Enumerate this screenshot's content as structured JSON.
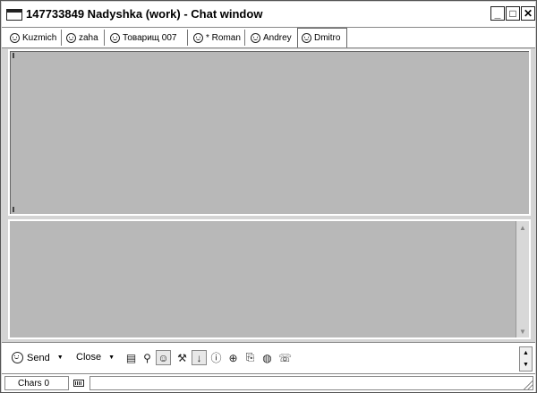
{
  "window": {
    "title": "147733849 Nadyshka (work) - Chat window",
    "min_label": "_",
    "max_label": "□",
    "close_label": "✕"
  },
  "tabs": [
    {
      "label": "Kuzmich",
      "icon": "smiley-icon"
    },
    {
      "label": "zaha",
      "icon": "smiley-icon"
    },
    {
      "label": "Товарищ 007",
      "icon": "smiley-icon"
    },
    {
      "label": "* Roman",
      "icon": "smiley-icon"
    },
    {
      "label": "Andrey",
      "icon": "smiley-icon"
    },
    {
      "label": "Dmitro",
      "icon": "smiley-icon",
      "active": true
    }
  ],
  "toolbar": {
    "send_label": "Send",
    "close_label": "Close",
    "icons": [
      "history-icon",
      "search-icon",
      "smileys-icon",
      "tools-icon",
      "download-icon",
      "info-icon",
      "zoom-icon",
      "send-file-icon",
      "web-icon",
      "phone-icon"
    ]
  },
  "status": {
    "chars": "Chars 0"
  }
}
